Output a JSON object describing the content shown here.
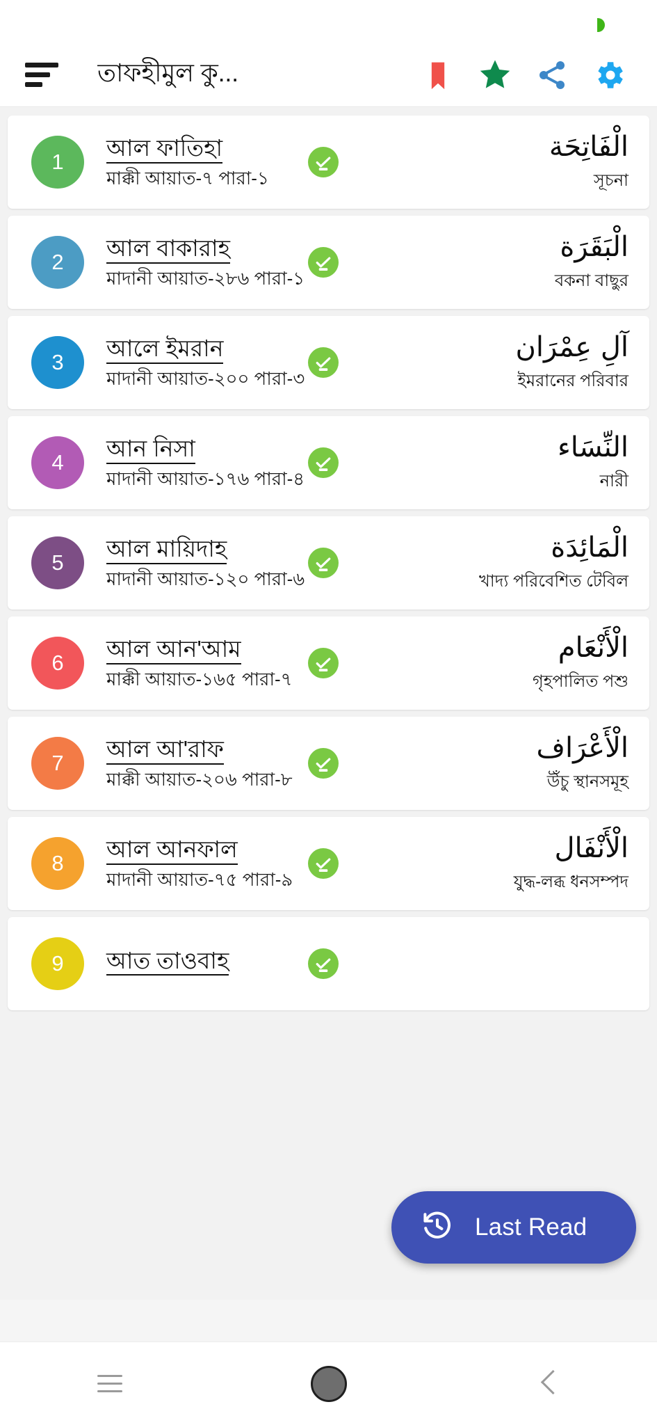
{
  "statusbar": {
    "indicator": "green-dot"
  },
  "appbar": {
    "menu_icon": "hamburger-menu-icon",
    "title": "তাফহীমুল কু...",
    "actions": [
      {
        "name": "bookmark-icon",
        "color": "#f0514a"
      },
      {
        "name": "star-icon",
        "color": "#0f8a4d"
      },
      {
        "name": "share-icon",
        "color": "#3d87c8"
      },
      {
        "name": "settings-gear-icon",
        "color": "#1ea7f0"
      }
    ]
  },
  "list": {
    "items": [
      {
        "number": "1",
        "color": "#5cb85c",
        "name": "আল ফাতিহা",
        "meta": "মাক্কী আয়াত-৭  পারা-১",
        "arabic": "الْفَاتِحَة",
        "meaning": "সূচনা",
        "read_status": "completed"
      },
      {
        "number": "2",
        "color": "#4c9cc4",
        "name": "আল বাকারাহ",
        "meta": "মাদানী আয়াত-২৮৬  পারা-১",
        "arabic": "الْبَقَرَة",
        "meaning": "বকনা বাছুর",
        "read_status": "completed"
      },
      {
        "number": "3",
        "color": "#1e90cf",
        "name": "আলে ইমরান",
        "meta": "মাদানী আয়াত-২০০  পারা-৩",
        "arabic": "آلِ عِمْرَان",
        "meaning": "ইমরানের পরিবার",
        "read_status": "completed"
      },
      {
        "number": "4",
        "color": "#b25bb5",
        "name": "আন নিসা",
        "meta": "মাদানী আয়াত-১৭৬ পারা-৪",
        "arabic": "النِّسَاء",
        "meaning": "নারী",
        "read_status": "completed"
      },
      {
        "number": "5",
        "color": "#7d4e85",
        "name": "আল মায়িদাহ",
        "meta": "মাদানী আয়াত-১২০  পারা-৬",
        "arabic": "الْمَائِدَة",
        "meaning": "খাদ্য পরিবেশিত টেবিল",
        "read_status": "completed"
      },
      {
        "number": "6",
        "color": "#f2565a",
        "name": "আল আন'আম",
        "meta": "মাক্কী আয়াত-১৬৫  পারা-৭",
        "arabic": "الْأَنْعَام",
        "meaning": "গৃহপালিত পশু",
        "read_status": "completed"
      },
      {
        "number": "7",
        "color": "#f37b46",
        "name": "আল আ'রাফ",
        "meta": "মাক্কী আয়াত-২০৬  পারা-৮",
        "arabic": "الْأَعْرَاف",
        "meaning": "উঁচু স্থানসমূহ",
        "read_status": "completed"
      },
      {
        "number": "8",
        "color": "#f5a22e",
        "name": "আল আনফাল",
        "meta": "মাদানী আয়াত-৭৫  পারা-৯",
        "arabic": "الْأَنْفَال",
        "meaning": "যুদ্ধ-লব্ধ ধনসম্পদ",
        "read_status": "completed"
      },
      {
        "number": "9",
        "color": "#e5cf15",
        "name": "আত তাওবাহ",
        "meta": "",
        "arabic": "",
        "meaning": "",
        "read_status": "completed"
      }
    ]
  },
  "fab": {
    "label": "Last Read",
    "icon": "history-clock-icon",
    "color": "#3f51b5"
  },
  "navbar": {
    "recents_icon": "recents-menu-icon",
    "home_icon": "home-circle-icon",
    "back_icon": "back-chevron-icon"
  }
}
